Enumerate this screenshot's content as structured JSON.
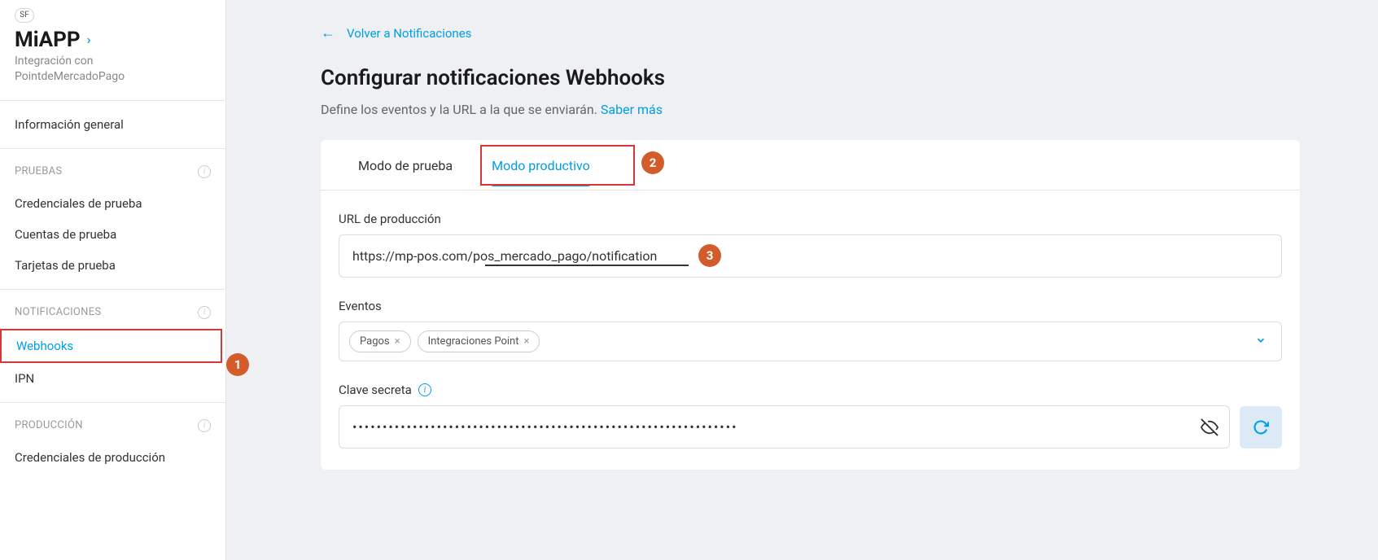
{
  "sidebar": {
    "avatar": "SF",
    "app_title": "MiAPP",
    "app_subtitle_line1": "Integración con",
    "app_subtitle_line2": "PointdeMercadoPago",
    "general_label": "Información general",
    "sections": {
      "pruebas": {
        "title": "PRUEBAS",
        "items": [
          "Credenciales de prueba",
          "Cuentas de prueba",
          "Tarjetas de prueba"
        ]
      },
      "notificaciones": {
        "title": "NOTIFICACIONES",
        "items": [
          "Webhooks",
          "IPN"
        ]
      },
      "produccion": {
        "title": "PRODUCCIÓN",
        "items": [
          "Credenciales de producción"
        ]
      }
    }
  },
  "main": {
    "back_label": "Volver a Notificaciones",
    "title": "Configurar notificaciones Webhooks",
    "desc_text": "Define los eventos y la URL a la que se enviarán. ",
    "desc_link": "Saber más",
    "tabs": {
      "test": "Modo de prueba",
      "prod": "Modo productivo"
    },
    "url_label": "URL de producción",
    "url_value": "https://mp-pos.com/pos_mercado_pago/notification",
    "events_label": "Eventos",
    "events_chips": [
      "Pagos",
      "Integraciones Point"
    ],
    "secret_label": "Clave secreta",
    "secret_value": "••••••••••••••••••••••••••••••••••••••••••••••••••••••••••••••••"
  },
  "annotations": {
    "n1": "1",
    "n2": "2",
    "n3": "3"
  }
}
